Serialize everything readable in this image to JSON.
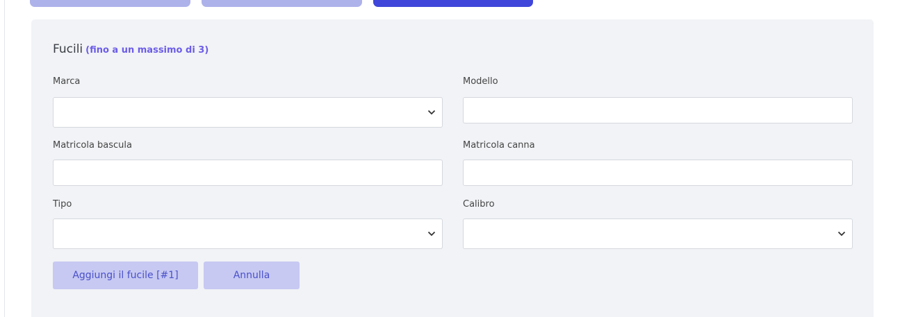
{
  "tabs": [
    "",
    "",
    ""
  ],
  "section": {
    "title": "Fucili",
    "note": "(fino a un massimo di 3)"
  },
  "fields": {
    "marca": {
      "label": "Marca",
      "value": ""
    },
    "modello": {
      "label": "Modello",
      "value": ""
    },
    "matricola_bascula": {
      "label": "Matricola bascula",
      "value": ""
    },
    "matricola_canna": {
      "label": "Matricola canna",
      "value": ""
    },
    "tipo": {
      "label": "Tipo",
      "value": ""
    },
    "calibro": {
      "label": "Calibro",
      "value": ""
    }
  },
  "buttons": {
    "add": "Aggiungi il fucile [#1]",
    "cancel": "Annulla"
  },
  "colors": {
    "accent": "#3f46d9",
    "tab_inactive": "#aeb2ea",
    "note": "#6c5ce7",
    "button_bg": "#c7c9f2",
    "panel_bg": "#f1f3f6"
  },
  "icons": {
    "select_arrow": "chevron-down-icon"
  }
}
